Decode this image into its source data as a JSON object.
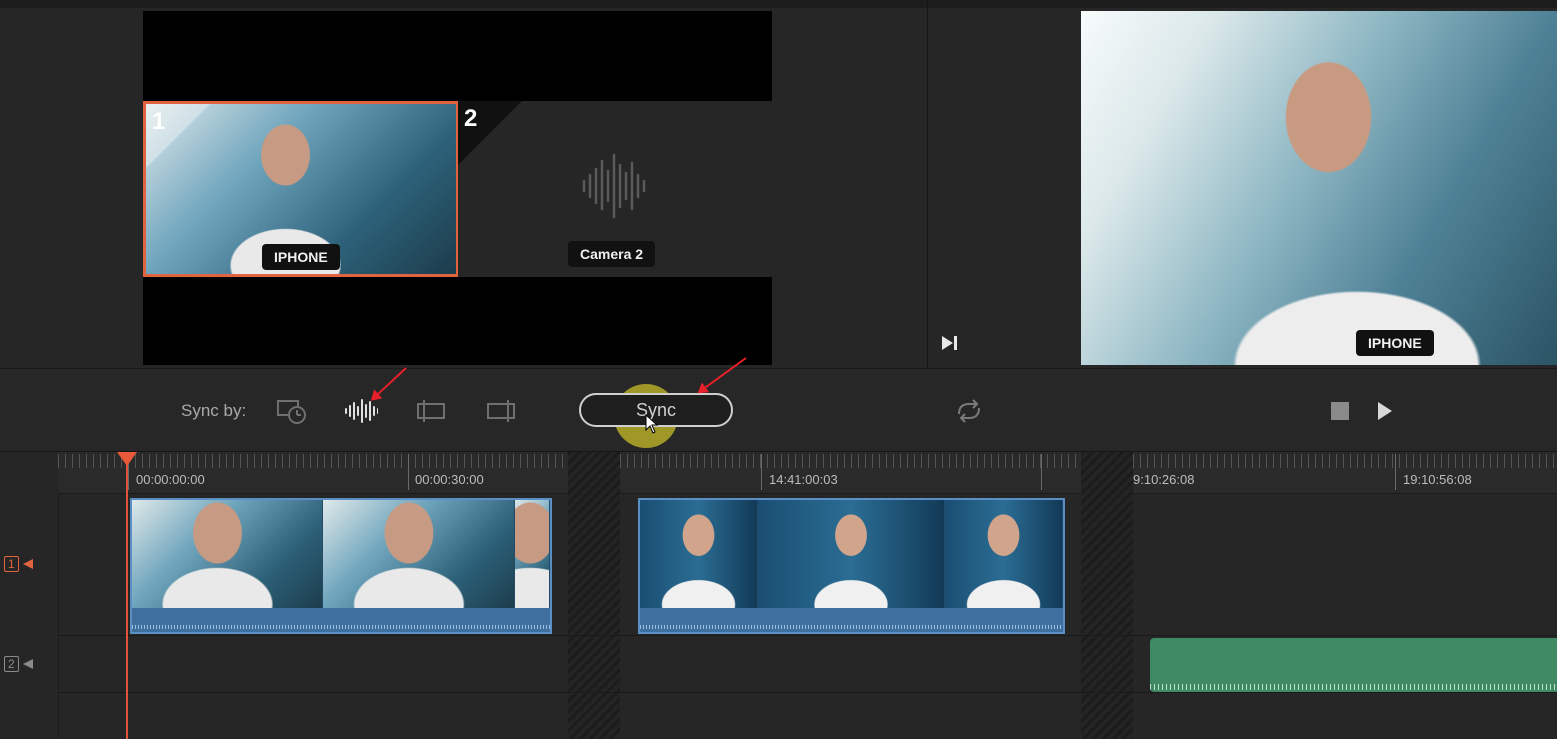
{
  "source_viewer": {
    "angles": [
      {
        "number": "1",
        "label": "IPHONE",
        "selected": true
      },
      {
        "number": "2",
        "label": "Camera 2",
        "selected": false
      }
    ]
  },
  "program_viewer": {
    "label": "IPHONE"
  },
  "toolbar": {
    "sync_by_label": "Sync by:",
    "sync_options": [
      "timecode-icon",
      "waveform-icon",
      "in-point-icon",
      "out-point-icon"
    ],
    "sync_button_label": "Sync"
  },
  "timeline": {
    "rulers": [
      {
        "timecodes": [
          "00:00:00:00",
          "00:00:30:00"
        ]
      },
      {
        "timecodes": [
          "14:41:00:03"
        ]
      },
      {
        "timecodes": [
          "9:10:26:08",
          "19:10:56:08"
        ]
      }
    ],
    "tracks": [
      {
        "number": "1",
        "color": "#e0643f"
      },
      {
        "number": "2",
        "color": "#8a8a8a"
      }
    ]
  },
  "colors": {
    "accent": "#e0643f",
    "video_clip": "#3b6d9d",
    "audio_clip": "#3f8a64",
    "annotation_arrow": "#e8202a"
  }
}
